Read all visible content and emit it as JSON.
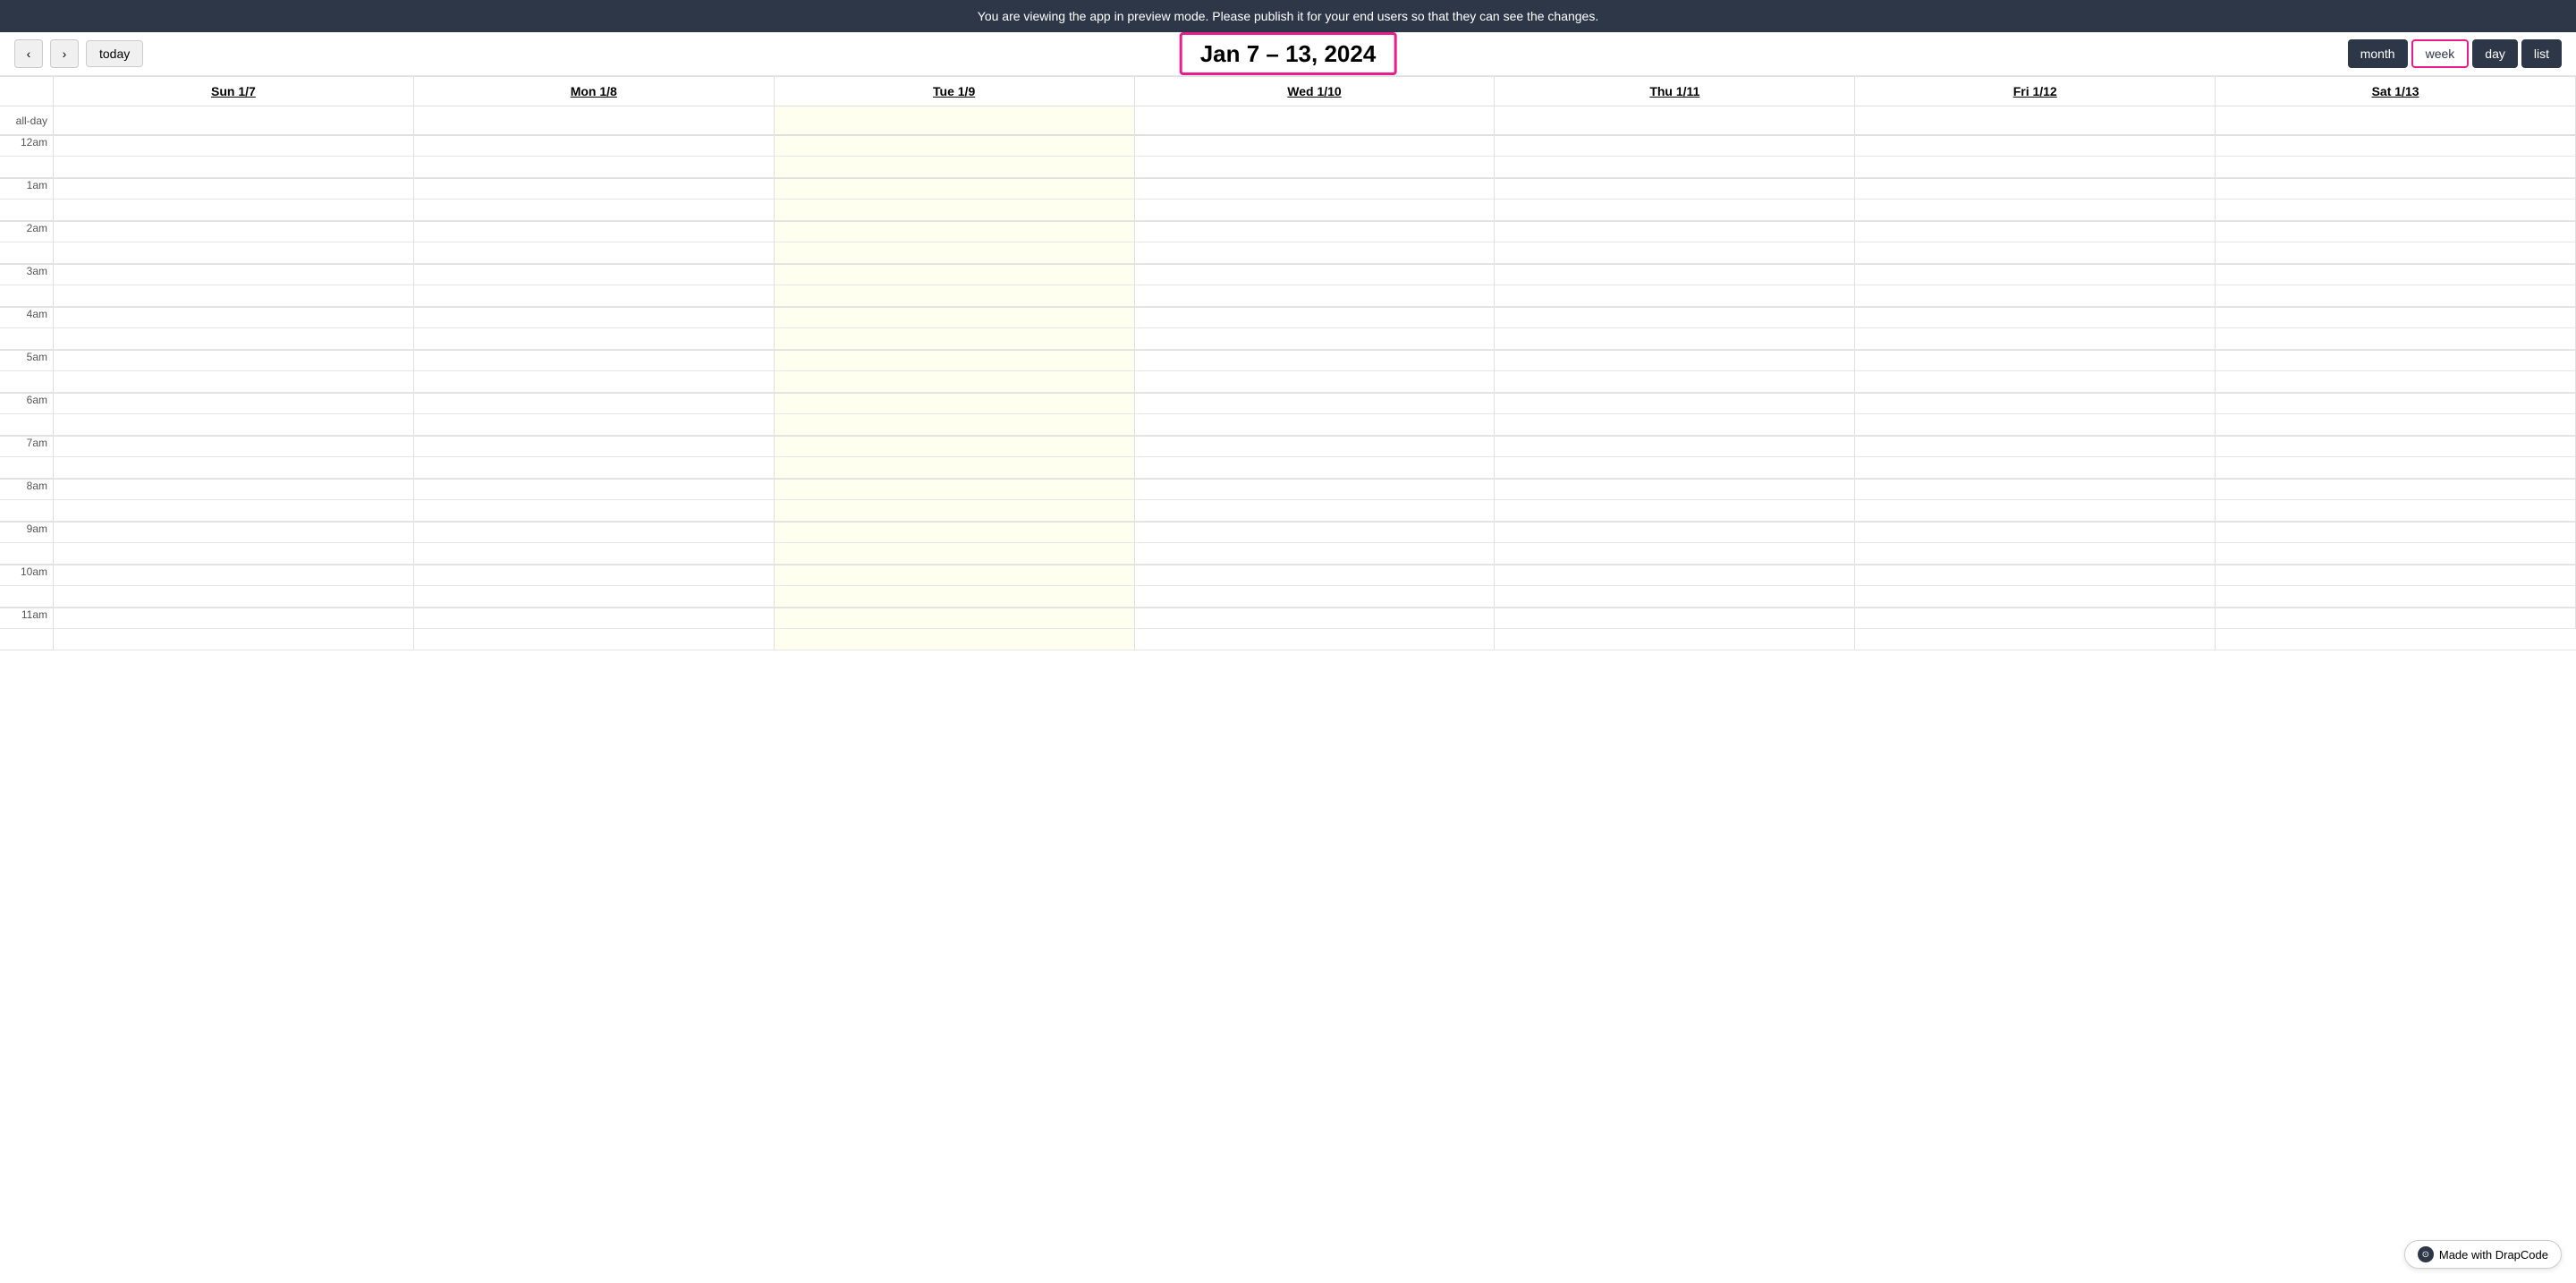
{
  "banner": {
    "text": "You are viewing the app in preview mode. Please publish it for your end users so that they can see the changes."
  },
  "nav": {
    "prev_label": "‹",
    "next_label": "›",
    "today_label": "today",
    "week_title": "Jan 7 – 13, 2024",
    "views": [
      {
        "id": "month",
        "label": "month"
      },
      {
        "id": "week",
        "label": "week",
        "active": true
      },
      {
        "id": "day",
        "label": "day"
      },
      {
        "id": "list",
        "label": "list"
      }
    ]
  },
  "calendar": {
    "columns": [
      {
        "id": "sun",
        "label": "Sun 1/7",
        "highlight": false
      },
      {
        "id": "mon",
        "label": "Mon 1/8",
        "highlight": false
      },
      {
        "id": "tue",
        "label": "Tue 1/9",
        "highlight": true
      },
      {
        "id": "wed",
        "label": "Wed 1/10",
        "highlight": false
      },
      {
        "id": "thu",
        "label": "Thu 1/11",
        "highlight": false
      },
      {
        "id": "fri",
        "label": "Fri 1/12",
        "highlight": false
      },
      {
        "id": "sat",
        "label": "Sat 1/13",
        "highlight": false
      }
    ],
    "allday_label": "all-day",
    "hours": [
      "12am",
      "1am",
      "2am",
      "3am",
      "4am",
      "5am",
      "6am",
      "7am",
      "8am",
      "9am",
      "10am",
      "11am"
    ]
  },
  "badge": {
    "text": "Made with DrapCode",
    "icon": "⊙"
  }
}
